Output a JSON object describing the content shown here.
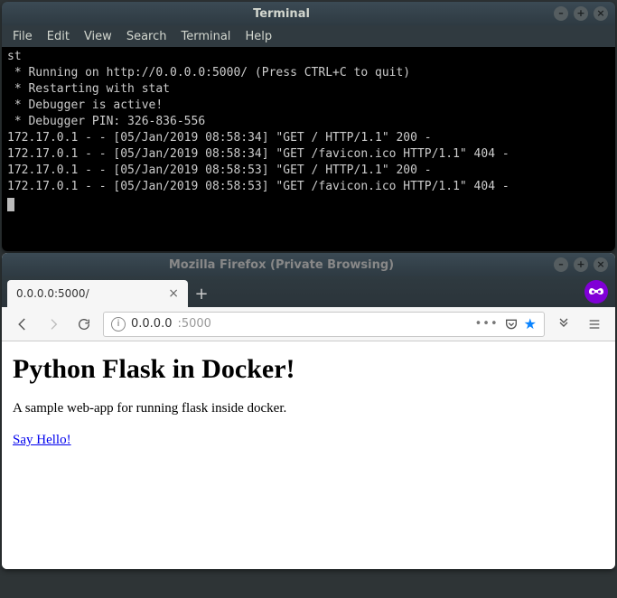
{
  "terminal": {
    "title": "Terminal",
    "menu": [
      "File",
      "Edit",
      "View",
      "Search",
      "Terminal",
      "Help"
    ],
    "lines": [
      "st",
      " * Running on http://0.0.0.0:5000/ (Press CTRL+C to quit)",
      " * Restarting with stat",
      " * Debugger is active!",
      " * Debugger PIN: 326-836-556",
      "172.17.0.1 - - [05/Jan/2019 08:58:34] \"GET / HTTP/1.1\" 200 -",
      "172.17.0.1 - - [05/Jan/2019 08:58:34] \"GET /favicon.ico HTTP/1.1\" 404 -",
      "172.17.0.1 - - [05/Jan/2019 08:58:53] \"GET / HTTP/1.1\" 200 -",
      "172.17.0.1 - - [05/Jan/2019 08:58:53] \"GET /favicon.ico HTTP/1.1\" 404 -"
    ]
  },
  "firefox": {
    "title": "Mozilla Firefox (Private Browsing)",
    "tab_label": "0.0.0.0:5000/",
    "url_host": "0.0.0.0",
    "url_port_path": ":5000",
    "dots": "•••"
  },
  "page": {
    "heading": "Python Flask in Docker!",
    "paragraph": "A sample web-app for running flask inside docker.",
    "link_text": "Say Hello!"
  }
}
